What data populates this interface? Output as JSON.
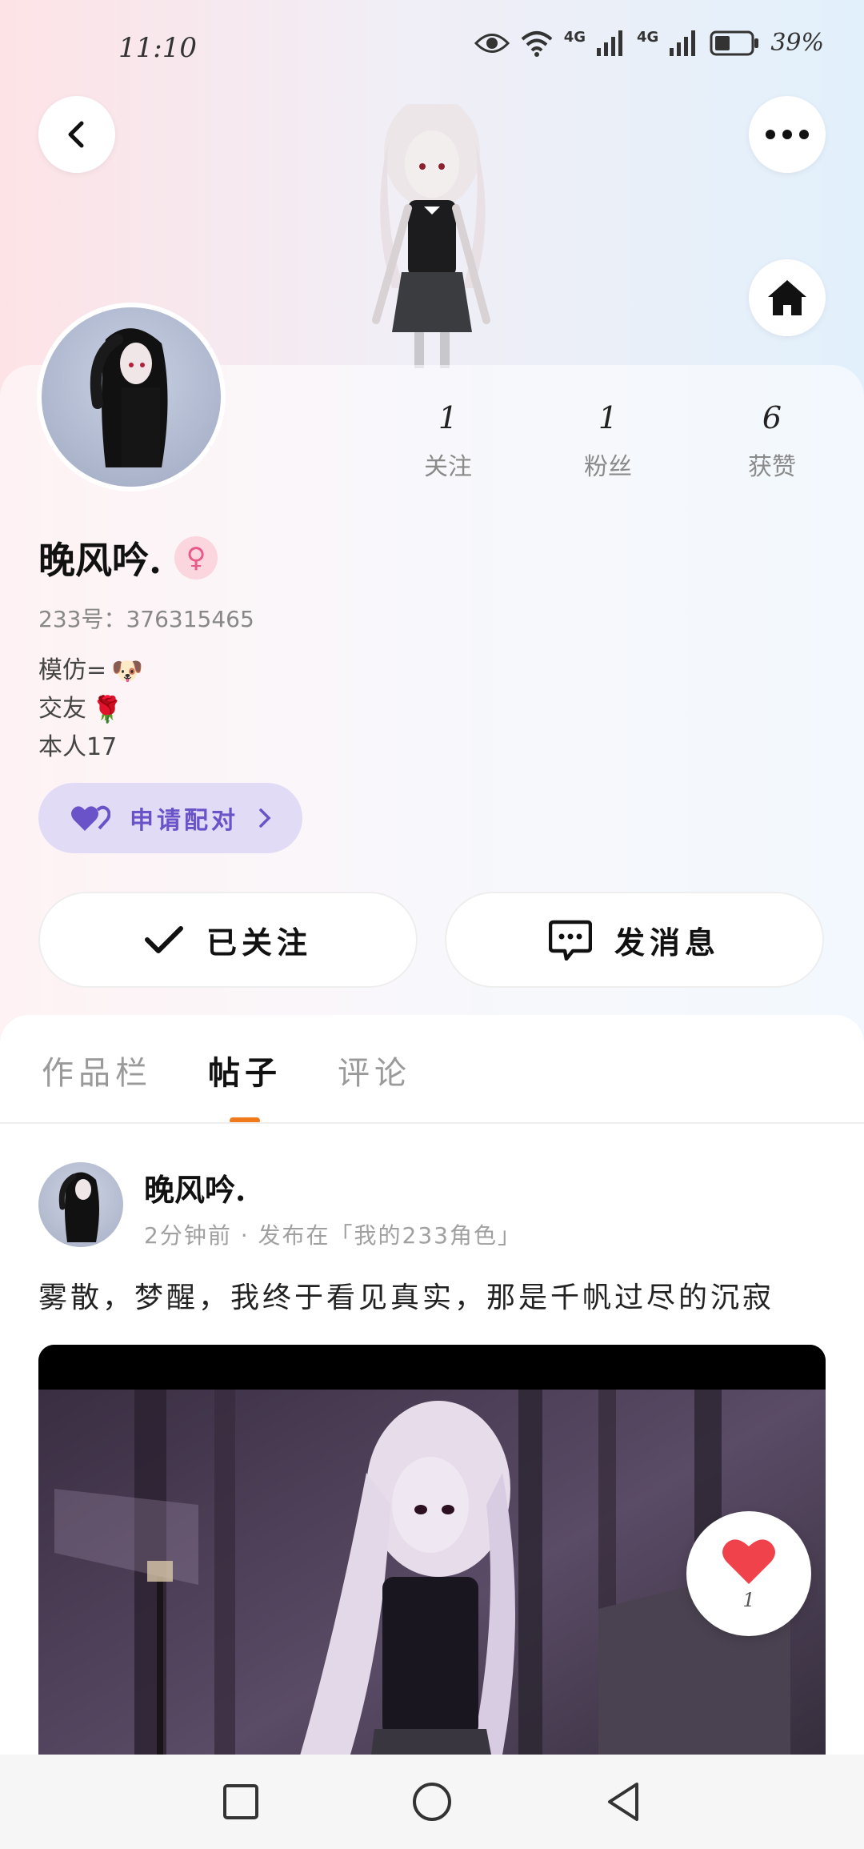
{
  "status_bar": {
    "time": "11:10",
    "network_1": "4G",
    "network_2": "4G",
    "battery": "39%"
  },
  "header": {
    "back_icon": "chevron-left-icon",
    "more_icon": "more-dots-icon",
    "home_icon": "home-icon"
  },
  "profile": {
    "stats": [
      {
        "value": "1",
        "label": "关注"
      },
      {
        "value": "1",
        "label": "粉丝"
      },
      {
        "value": "6",
        "label": "获赞"
      }
    ],
    "username": "晚风吟.",
    "gender_symbol": "♀",
    "user_id": "233号：376315465",
    "bio": [
      {
        "text": "模仿=",
        "emoji": "🐶"
      },
      {
        "text": "交友",
        "emoji": "🌹"
      },
      {
        "text": "本人17",
        "emoji": ""
      }
    ],
    "pair_button": "申请配对",
    "follow_button": "已关注",
    "message_button": "发消息"
  },
  "tabs": [
    {
      "label": "作品栏",
      "active": false
    },
    {
      "label": "帖子",
      "active": true
    },
    {
      "label": "评论",
      "active": false
    }
  ],
  "post": {
    "author": "晚风吟.",
    "meta": "2分钟前 · 发布在「我的233角色」",
    "text": "雾散，梦醒，我终于看见真实，那是千帆过尽的沉寂",
    "like_count": "1"
  },
  "colors": {
    "accent_orange": "#f07a1a",
    "pair_purple": "#6a52c8",
    "heart_red": "#f0424a"
  }
}
